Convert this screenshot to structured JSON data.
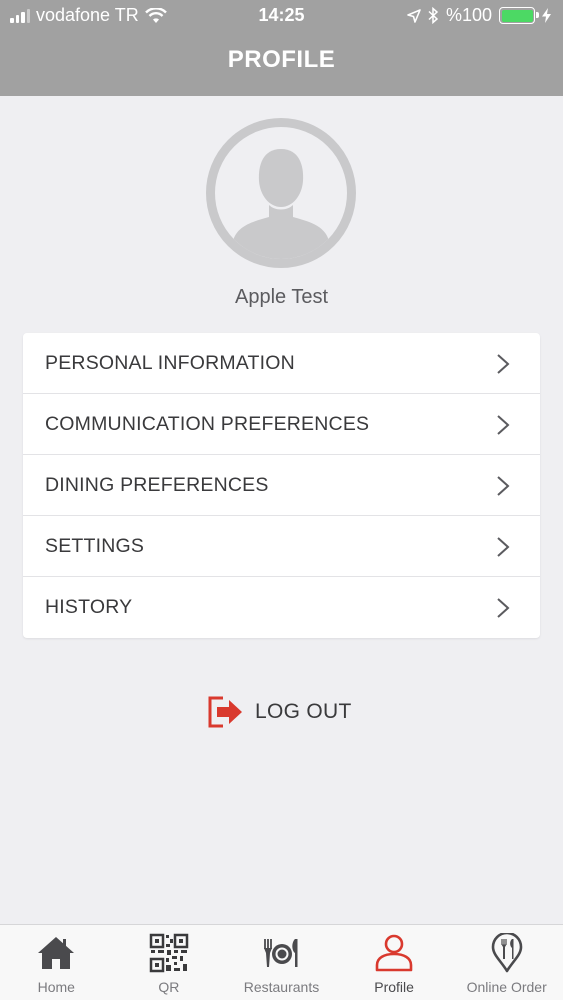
{
  "status_bar": {
    "carrier": "vodafone TR",
    "time": "14:25",
    "battery": "%100",
    "battery_level": 1.0
  },
  "header": {
    "title": "PROFILE"
  },
  "profile": {
    "name": "Apple Test"
  },
  "menu": {
    "items": [
      {
        "label": "PERSONAL INFORMATION",
        "icon": "chevron-right-icon"
      },
      {
        "label": "COMMUNICATION PREFERENCES",
        "icon": "chevron-right-icon"
      },
      {
        "label": "DINING PREFERENCES",
        "icon": "chevron-right-icon"
      },
      {
        "label": "SETTINGS",
        "icon": "chevron-right-icon"
      },
      {
        "label": "HISTORY",
        "icon": "chevron-right-icon"
      }
    ]
  },
  "logout": {
    "label": "LOG OUT",
    "icon": "logout-icon"
  },
  "tab_bar": {
    "tabs": [
      {
        "label": "Home",
        "icon": "home-icon"
      },
      {
        "label": "QR",
        "icon": "qr-code-icon"
      },
      {
        "label": "Restaurants",
        "icon": "plate-cutlery-icon"
      },
      {
        "label": "Profile",
        "icon": "person-icon",
        "active": true
      },
      {
        "label": "Online Order",
        "icon": "map-pin-cutlery-icon"
      }
    ]
  },
  "colors": {
    "header_bg": "#a1a1a1",
    "page_bg": "#efeff2",
    "accent_red": "#d9392e",
    "battery_green": "#4cd964"
  }
}
